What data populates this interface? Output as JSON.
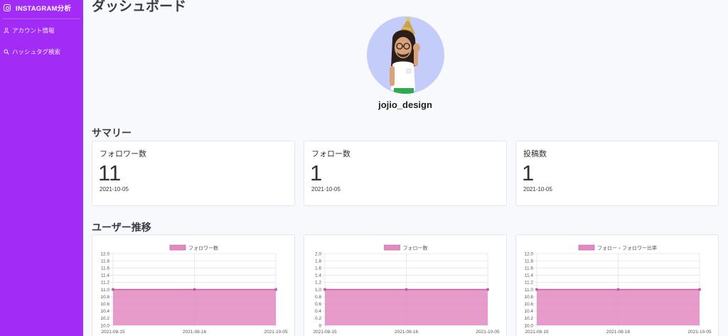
{
  "sidebar": {
    "brand": "INSTAGRAM分析",
    "brand_icon": "instagram-icon",
    "items": [
      {
        "label": "アカウント情報",
        "icon": "user-icon"
      },
      {
        "label": "ハッシュタグ検索",
        "icon": "search-icon"
      }
    ],
    "bg_color": "#a22cf5"
  },
  "header": {
    "title": "ダッシュボード"
  },
  "profile": {
    "username": "jojio_design",
    "avatar_bg": "#c4cdf9"
  },
  "summary": {
    "title": "サマリー",
    "cards": [
      {
        "label": "フォロワー数",
        "value": "11",
        "date": "2021-10-05"
      },
      {
        "label": "フォロー数",
        "value": "1",
        "date": "2021-10-05"
      },
      {
        "label": "投稿数",
        "value": "1",
        "date": "2021-10-05"
      }
    ]
  },
  "trend": {
    "title": "ユーザー推移"
  },
  "chart_data": [
    {
      "type": "area",
      "legend": [
        "フォロワー数"
      ],
      "x": [
        "2021-08-15",
        "2021-08-16",
        "2021-10-05"
      ],
      "series": [
        {
          "name": "フォロワー数",
          "values": [
            11,
            11,
            11
          ]
        }
      ],
      "ylim": [
        10,
        12
      ],
      "yticks": [
        "12.0",
        "11.8",
        "11.6",
        "11.4",
        "11.2",
        "11.0",
        "10.8",
        "10.6",
        "10.4",
        "10.2",
        "10.0"
      ],
      "color": "#e289c2",
      "grid": true,
      "legend_position": "top"
    },
    {
      "type": "area",
      "legend": [
        "フォロー数"
      ],
      "x": [
        "2021-08-15",
        "2021-08-16",
        "2021-10-05"
      ],
      "series": [
        {
          "name": "フォロー数",
          "values": [
            1,
            1,
            1
          ]
        }
      ],
      "ylim": [
        0,
        2
      ],
      "yticks": [
        "2.0",
        "1.8",
        "1.6",
        "1.4",
        "1.2",
        "1.0",
        "0.8",
        "0.6",
        "0.4",
        "0.2",
        "0"
      ],
      "color": "#e289c2",
      "grid": true,
      "legend_position": "top"
    },
    {
      "type": "area",
      "legend": [
        "フォロー・フォロワー比率"
      ],
      "x": [
        "2021-08-15",
        "2021-08-16",
        "2021-10-05"
      ],
      "series": [
        {
          "name": "フォロー・フォロワー比率",
          "values": [
            11,
            11,
            11
          ]
        }
      ],
      "ylim": [
        10,
        12
      ],
      "yticks": [
        "12.0",
        "11.8",
        "11.6",
        "11.4",
        "11.2",
        "11.0",
        "10.8",
        "10.6",
        "10.4",
        "10.2",
        "10.0"
      ],
      "color": "#e289c2",
      "grid": true,
      "legend_position": "top"
    }
  ]
}
